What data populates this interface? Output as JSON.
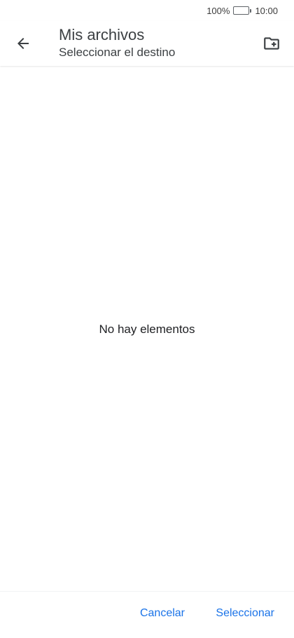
{
  "status_bar": {
    "battery_percent": "100%",
    "battery_level": 1.0,
    "time": "10:00"
  },
  "app_bar": {
    "title": "Mis archivos",
    "subtitle": "Seleccionar el destino",
    "back_icon": "arrow-left-icon",
    "new_folder_icon": "new-folder-icon"
  },
  "content": {
    "empty_message": "No hay elementos"
  },
  "footer": {
    "cancel_label": "Cancelar",
    "select_label": "Seleccionar"
  },
  "colors": {
    "accent": "#1a73e8",
    "icon": "#3c4043",
    "text": "#202124"
  }
}
